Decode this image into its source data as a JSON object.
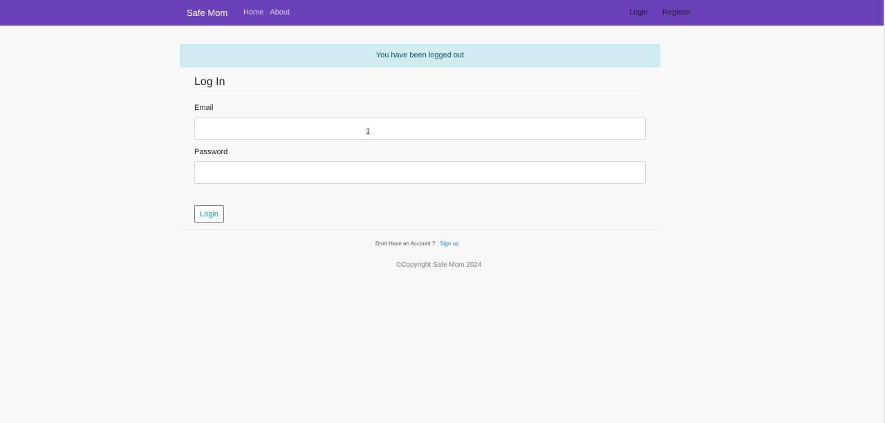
{
  "navbar": {
    "brand": "Safe Mom",
    "left_links": [
      "Home",
      "About"
    ],
    "right_links": [
      "Login",
      "Register"
    ],
    "color": "#6a41b8"
  },
  "alert": {
    "message": "You have been logged out"
  },
  "login_form": {
    "title": "Log In",
    "email_label": "Email",
    "email_value": "",
    "password_label": "Password",
    "password_value": "",
    "submit_label": "Login"
  },
  "signup": {
    "prompt": "Dont Have an Account ?",
    "link_label": "Sign up"
  },
  "footer": {
    "copyright": "©Copyright Safe Mom 2024"
  },
  "colors": {
    "accent": "#17a2b8",
    "alert_bg": "#d1ecf1",
    "link": "#2a7ae2"
  },
  "icons": {
    "text_cursor": "text-cursor-icon"
  }
}
